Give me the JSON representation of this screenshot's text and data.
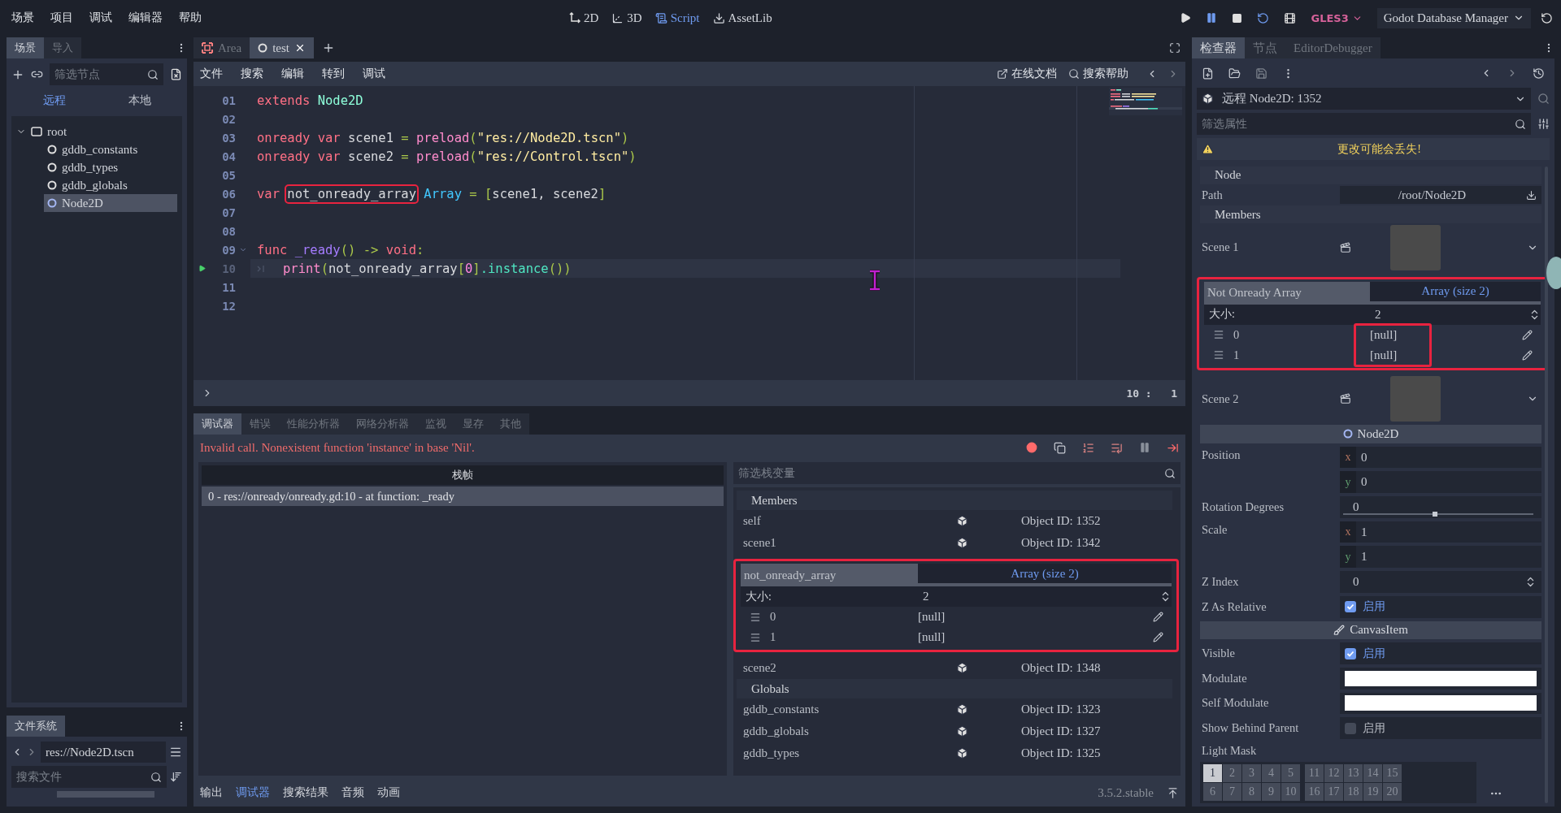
{
  "menu": [
    "场景",
    "项目",
    "调试",
    "编辑器",
    "帮助"
  ],
  "workspaces": [
    {
      "label": "2D",
      "kind": "plane",
      "selected": false
    },
    {
      "label": "3D",
      "kind": "space",
      "selected": false
    },
    {
      "label": "Script",
      "kind": "script",
      "selected": true
    },
    {
      "label": "AssetLib",
      "kind": "assetlib",
      "selected": false
    }
  ],
  "run_controls": {
    "paused": true
  },
  "renderer": "GLES3",
  "project": "Godot Database Manager",
  "scene_dock": {
    "tabs": [
      {
        "label": "场景",
        "selected": true
      },
      {
        "label": "导入",
        "selected": false
      }
    ],
    "filter_placeholder": "筛选节点",
    "modes": [
      {
        "label": "远程",
        "selected": true
      },
      {
        "label": "本地",
        "selected": false
      }
    ],
    "tree": {
      "label": "root",
      "kind": "control",
      "expanded": true,
      "selected": false,
      "children": [
        {
          "label": "gddb_constants",
          "kind": "node",
          "selected": false
        },
        {
          "label": "gddb_types",
          "kind": "node",
          "selected": false
        },
        {
          "label": "gddb_globals",
          "kind": "node",
          "selected": false
        },
        {
          "label": "Node2D",
          "kind": "node2d",
          "selected": true
        }
      ]
    }
  },
  "filesystem": {
    "tab": "文件系统",
    "path": "res://Node2D.tscn",
    "search_placeholder": "搜索文件"
  },
  "script_tabs": [
    {
      "label": "Area",
      "kind": "scene",
      "selected": false
    },
    {
      "label": "test",
      "kind": "node",
      "selected": true
    }
  ],
  "script_menu": [
    "文件",
    "搜索",
    "编辑",
    "转到",
    "调试"
  ],
  "script_links": [
    {
      "label": "在线文档",
      "kind": "docs"
    },
    {
      "label": "搜索帮助",
      "kind": "help"
    }
  ],
  "code": [
    {
      "number": "01",
      "tokens": [
        {
          "kind": "keyword",
          "text": "extends "
        },
        {
          "kind": "type",
          "text": "Node2D"
        }
      ]
    },
    {
      "number": "02"
    },
    {
      "number": "03",
      "tokens": [
        {
          "kind": "keyword",
          "text": "onready var"
        },
        {
          "kind": "plain",
          "text": " scene1 "
        },
        {
          "kind": "symbol",
          "text": "= "
        },
        {
          "kind": "builtin",
          "text": "preload"
        },
        {
          "kind": "symbol",
          "text": "("
        },
        {
          "kind": "string",
          "text": "\"res://Node2D.tscn\""
        },
        {
          "kind": "symbol",
          "text": ")"
        }
      ]
    },
    {
      "number": "04",
      "tokens": [
        {
          "kind": "keyword",
          "text": "onready var"
        },
        {
          "kind": "plain",
          "text": " scene2 "
        },
        {
          "kind": "symbol",
          "text": "= "
        },
        {
          "kind": "builtin",
          "text": "preload"
        },
        {
          "kind": "symbol",
          "text": "("
        },
        {
          "kind": "string",
          "text": "\"res://Control.tscn\""
        },
        {
          "kind": "symbol",
          "text": ")"
        }
      ]
    },
    {
      "number": "05"
    },
    {
      "number": "06",
      "tokens": [
        {
          "kind": "keyword",
          "text": "var "
        },
        {
          "kind": "plain",
          "text": "not_onready_array",
          "highlighted": true
        },
        {
          "kind": "type2",
          "text": " Array"
        },
        {
          "kind": "symbol",
          "text": " = ["
        },
        {
          "kind": "plain",
          "text": "scene1, scene2"
        },
        {
          "kind": "symbol",
          "text": "]"
        }
      ]
    },
    {
      "number": "07"
    },
    {
      "number": "08"
    },
    {
      "number": "09",
      "foldable": true,
      "tokens": [
        {
          "kind": "keyword",
          "text": "func "
        },
        {
          "kind": "func",
          "text": "_ready"
        },
        {
          "kind": "symbol",
          "text": "() -> "
        },
        {
          "kind": "keyword",
          "text": "void"
        },
        {
          "kind": "symbol",
          "text": ":"
        }
      ]
    },
    {
      "number": "10",
      "current": true,
      "indent": true,
      "tokens": [
        {
          "kind": "builtin",
          "text": "print"
        },
        {
          "kind": "symbol",
          "text": "("
        },
        {
          "kind": "plain",
          "text": "not_onready_array"
        },
        {
          "kind": "symbol",
          "text": "["
        },
        {
          "kind": "number",
          "text": "0"
        },
        {
          "kind": "symbol",
          "text": "]"
        },
        {
          "kind": "member",
          "text": ".instance"
        },
        {
          "kind": "symbol",
          "text": "())"
        }
      ]
    },
    {
      "number": "11"
    },
    {
      "number": "12"
    }
  ],
  "caret_position": "10 :   1",
  "debugger": {
    "tabs": [
      {
        "label": "调试器",
        "selected": true
      },
      {
        "label": "错误",
        "selected": false
      },
      {
        "label": "性能分析器",
        "selected": false
      },
      {
        "label": "网络分析器",
        "selected": false
      },
      {
        "label": "监视",
        "selected": false
      },
      {
        "label": "显存",
        "selected": false
      },
      {
        "label": "其他",
        "selected": false
      }
    ],
    "error": "Invalid call. Nonexistent function 'instance' in base 'Nil'.",
    "stack_header": "栈帧",
    "stack_frames": [
      {
        "text": "0 - res://onready/onready.gd:10 - at function: _ready",
        "selected": true
      }
    ],
    "vars_filter_placeholder": "筛选栈变量",
    "sections": [
      {
        "title": "Members",
        "rows": [
          {
            "kind": "object",
            "name": "self",
            "value": "Object ID: 1352"
          },
          {
            "kind": "object",
            "name": "scene1",
            "value": "Object ID: 1342"
          },
          {
            "kind": "array",
            "name": "not_onready_array",
            "value": "Array (size 2)",
            "highlighted": true,
            "size_label": "大小:",
            "size": "2",
            "items": [
              {
                "index": "0",
                "value": "[null]"
              },
              {
                "index": "1",
                "value": "[null]"
              }
            ]
          },
          {
            "kind": "object",
            "name": "scene2",
            "value": "Object ID: 1348"
          }
        ]
      },
      {
        "title": "Globals",
        "rows": [
          {
            "kind": "object",
            "name": "gddb_constants",
            "value": "Object ID: 1323"
          },
          {
            "kind": "object",
            "name": "gddb_globals",
            "value": "Object ID: 1327"
          },
          {
            "kind": "object",
            "name": "gddb_types",
            "value": "Object ID: 1325"
          }
        ]
      }
    ]
  },
  "bottom_tabs": [
    {
      "label": "输出",
      "selected": false
    },
    {
      "label": "调试器",
      "selected": true
    },
    {
      "label": "搜索结果",
      "selected": false
    },
    {
      "label": "音频",
      "selected": false
    },
    {
      "label": "动画",
      "selected": false
    }
  ],
  "version": "3.5.2.stable",
  "inspector": {
    "tabs": [
      {
        "label": "检查器",
        "selected": true
      },
      {
        "label": "节点",
        "selected": false
      },
      {
        "label": "EditorDebugger",
        "selected": false
      }
    ],
    "object": "远程 Node2D:  1352",
    "filter_placeholder": "筛选属性",
    "warning": "更改可能会丢失!",
    "properties": [
      {
        "kind": "category",
        "label": "Node"
      },
      {
        "kind": "path",
        "label": "Path",
        "value": "/root/Node2D"
      },
      {
        "kind": "category",
        "label": "Members"
      },
      {
        "kind": "resource",
        "label": "Scene 1"
      },
      {
        "kind": "array",
        "label": "Not Onready Array",
        "value": "Array (size 2)",
        "highlighted": true,
        "values_highlighted": true,
        "size_label": "大小:",
        "size": "2",
        "items": [
          {
            "index": "0",
            "value": "[null]"
          },
          {
            "index": "1",
            "value": "[null]"
          }
        ]
      },
      {
        "kind": "resource",
        "label": "Scene 2"
      },
      {
        "kind": "header",
        "label": "Node2D"
      },
      {
        "kind": "vector",
        "label": "Position",
        "components": [
          {
            "axis": "x",
            "value": "0"
          },
          {
            "axis": "y",
            "value": "0"
          }
        ]
      },
      {
        "kind": "slider",
        "label": "Rotation Degrees",
        "value": "0",
        "level": 0.47
      },
      {
        "kind": "vector",
        "label": "Scale",
        "components": [
          {
            "axis": "x",
            "value": "1"
          },
          {
            "axis": "y",
            "value": "1"
          }
        ]
      },
      {
        "kind": "spin",
        "label": "Z Index",
        "value": "0"
      },
      {
        "kind": "check",
        "label": "Z As Relative",
        "checked": true,
        "text": "启用"
      },
      {
        "kind": "header",
        "label": "CanvasItem"
      },
      {
        "kind": "check",
        "label": "Visible",
        "checked": true,
        "text": "启用"
      },
      {
        "kind": "color",
        "label": "Modulate",
        "color": "#ffffff"
      },
      {
        "kind": "color",
        "label": "Self Modulate",
        "color": "#ffffff"
      },
      {
        "kind": "check",
        "label": "Show Behind Parent",
        "checked": false,
        "text": "启用"
      },
      {
        "kind": "layers",
        "label": "Light Mask",
        "layers": [
          {
            "label": "1",
            "selected": true
          },
          {
            "label": "2",
            "selected": false
          },
          {
            "label": "3",
            "selected": false
          },
          {
            "label": "4",
            "selected": false
          },
          {
            "label": "5",
            "selected": false
          },
          {
            "label": "11",
            "selected": false
          },
          {
            "label": "12",
            "selected": false
          },
          {
            "label": "13",
            "selected": false
          },
          {
            "label": "14",
            "selected": false
          },
          {
            "label": "15",
            "selected": false
          },
          {
            "label": "6",
            "selected": false
          },
          {
            "label": "7",
            "selected": false
          },
          {
            "label": "8",
            "selected": false
          },
          {
            "label": "9",
            "selected": false
          },
          {
            "label": "10",
            "selected": false
          },
          {
            "label": "16",
            "selected": false
          },
          {
            "label": "17",
            "selected": false
          },
          {
            "label": "18",
            "selected": false
          },
          {
            "label": "19",
            "selected": false
          },
          {
            "label": "20",
            "selected": false
          }
        ]
      }
    ]
  }
}
